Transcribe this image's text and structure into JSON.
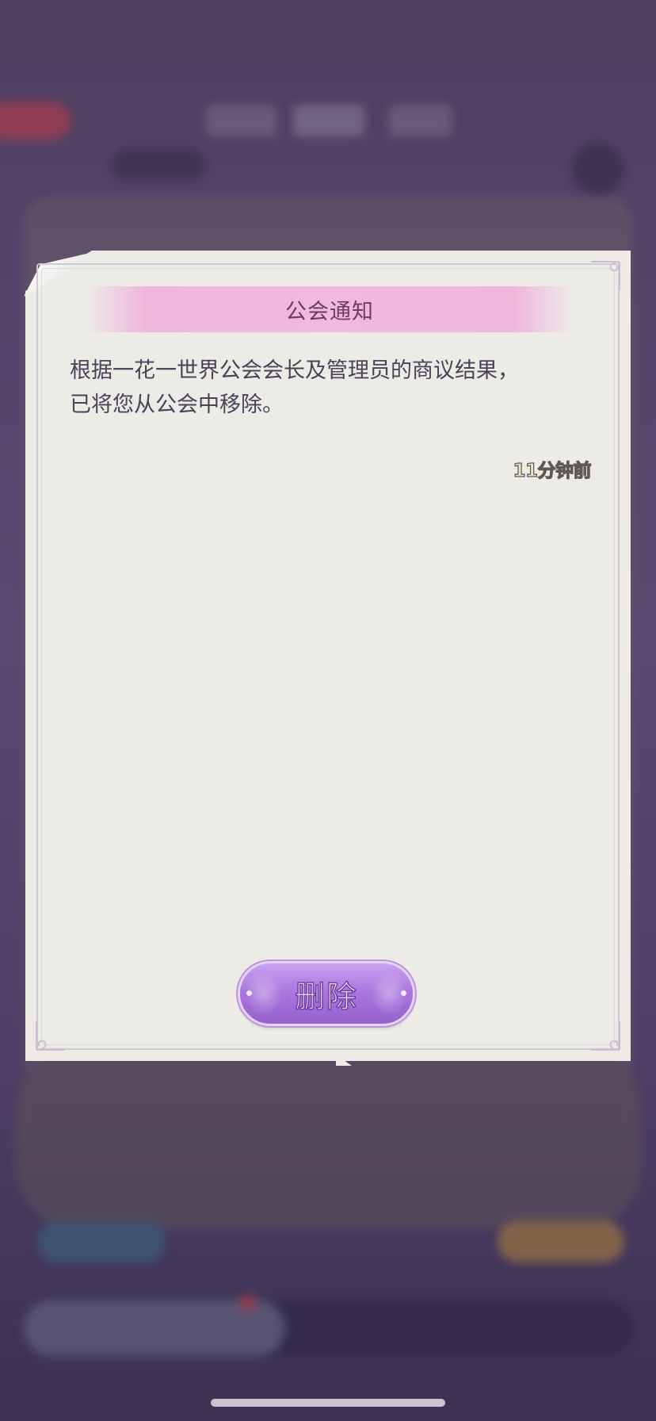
{
  "dialog": {
    "title": "公会通知",
    "message_lines": [
      "根据一花一世界公会会长及管理员的商议结果，",
      "已将您从公会中移除。"
    ],
    "timestamp": "11分钟前",
    "delete_label": "删除"
  },
  "icons": {
    "corner_ornament": "flourish-corner-icon",
    "page_fold": "page-fold-icon"
  },
  "colors": {
    "paper": "#ecebe6",
    "title_banner": "#f1b9de",
    "title_text": "#6b3d66",
    "button": "#a874dd",
    "overlay": "#55446a"
  }
}
